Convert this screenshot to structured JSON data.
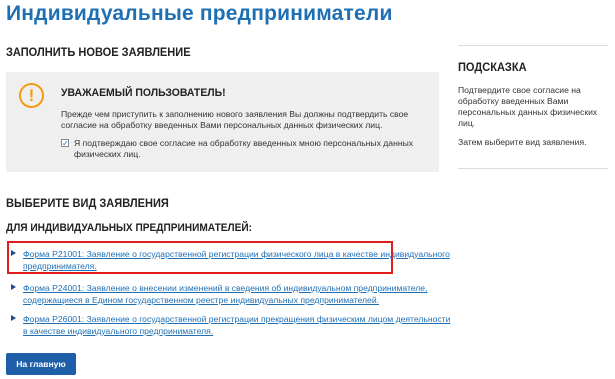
{
  "page": {
    "title": "Индивидуальные предприниматели"
  },
  "new_application": {
    "heading": "ЗАПОЛНИТЬ НОВОЕ ЗАЯВЛЕНИЕ",
    "notice": {
      "icon": "exclamation-icon",
      "title": "УВАЖАЕМЫЙ ПОЛЬЗОВАТЕЛЬ!",
      "text": "Прежде чем приступить к заполнению нового заявления Вы должны подтвердить свое согласие на обработку введенных Вами персональных данных физических лиц.",
      "consent_checked": true,
      "consent_label": "Я подтверждаю свое согласие на обработку введенных мною персональных данных физических лиц."
    }
  },
  "hint": {
    "heading": "ПОДСКАЗКА",
    "line1": "Подтвердите свое согласие на обработку введенных Вами персональных данных физических лиц.",
    "line2": "Затем выберите вид заявления."
  },
  "choose": {
    "heading": "ВЫБЕРИТЕ ВИД ЗАЯВЛЕНИЯ",
    "subheading": "ДЛЯ ИНДИВИДУАЛЬНЫХ ПРЕДПРИНИМАТЕЛЕЙ:",
    "forms": [
      {
        "label": "Форма Р21001: Заявление о государственной регистрации физического лица в качестве индивидуального предпринимателя."
      },
      {
        "label": "Форма Р24001: Заявление о внесении изменений в сведения об индивидуальном предпринимателе, содержащиеся в Едином государственном реестре индивидуальных предпринимателей."
      },
      {
        "label": "Форма Р26001: Заявление о государственной регистрации прекращения физическим лицом деятельности в качестве индивидуального предпринимателя."
      }
    ]
  },
  "buttons": {
    "home_label": "На главную"
  },
  "colors": {
    "title": "#1f6fb5",
    "link": "#1f6fb5",
    "button": "#1f5faa",
    "warning": "#f39c12",
    "highlight": "#e21b1b",
    "notice_bg": "#efefef"
  }
}
